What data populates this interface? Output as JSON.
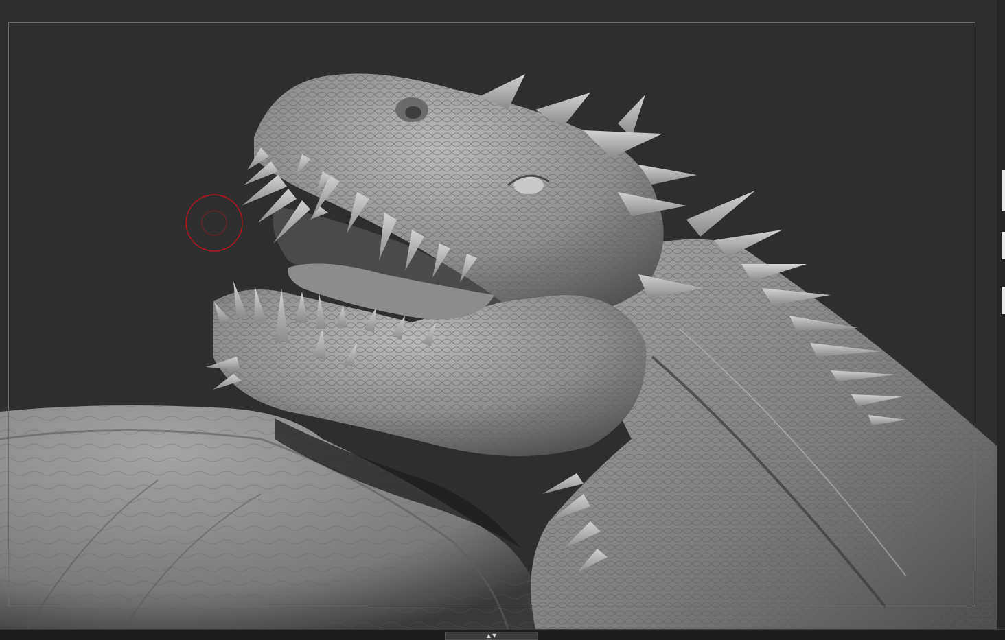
{
  "viewport": {
    "background_color": "#2e2e2e",
    "frame_color": "#6d6d6d"
  },
  "model": {
    "subject": "dragon-sculpt",
    "material_color": "#9a9a9a"
  },
  "brush_cursor": {
    "color": "#b0151a"
  },
  "shelf_toggle": {
    "up_icon": "▲",
    "down_icon": "▼"
  },
  "icons": {
    "brush": "brush-cursor-icon",
    "collapse": "collapse-shelf-icon"
  }
}
